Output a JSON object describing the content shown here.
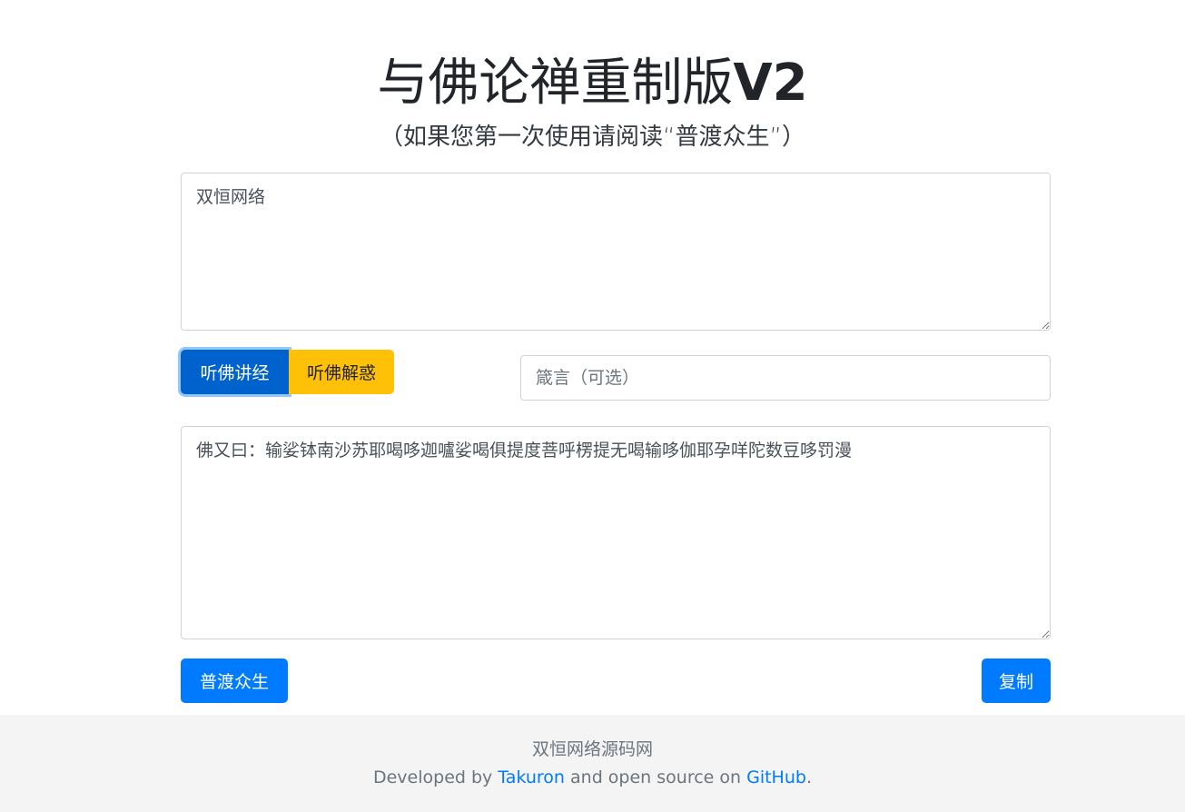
{
  "header": {
    "title_main": "与佛论禅重制版",
    "title_version": "V2",
    "subtitle": "（如果您第一次使用请阅读“普渡众生”）"
  },
  "input": {
    "value": "双恒网络"
  },
  "mode_buttons": {
    "encode_label": "听佛讲经",
    "decode_label": "听佛解惑"
  },
  "key": {
    "placeholder": "箴言（可选）",
    "value": ""
  },
  "output": {
    "value": "佛又曰：输娑钵南沙苏耶喝哆迦嚧娑喝俱提度菩呼楞提无喝输哆伽耶孕咩陀数豆哆罚漫"
  },
  "actions": {
    "help_label": "普渡众生",
    "copy_label": "复制"
  },
  "footer": {
    "site_name": "双恒网络源码网",
    "prefix": "Developed by",
    "author_link": "Takuron",
    "middle": "and open source on",
    "repo_link": "GitHub",
    "suffix": "."
  },
  "colors": {
    "primary": "#007bff",
    "primary_active": "#0062cc",
    "warning": "#ffc107",
    "footer_bg": "#f4f4f4"
  }
}
